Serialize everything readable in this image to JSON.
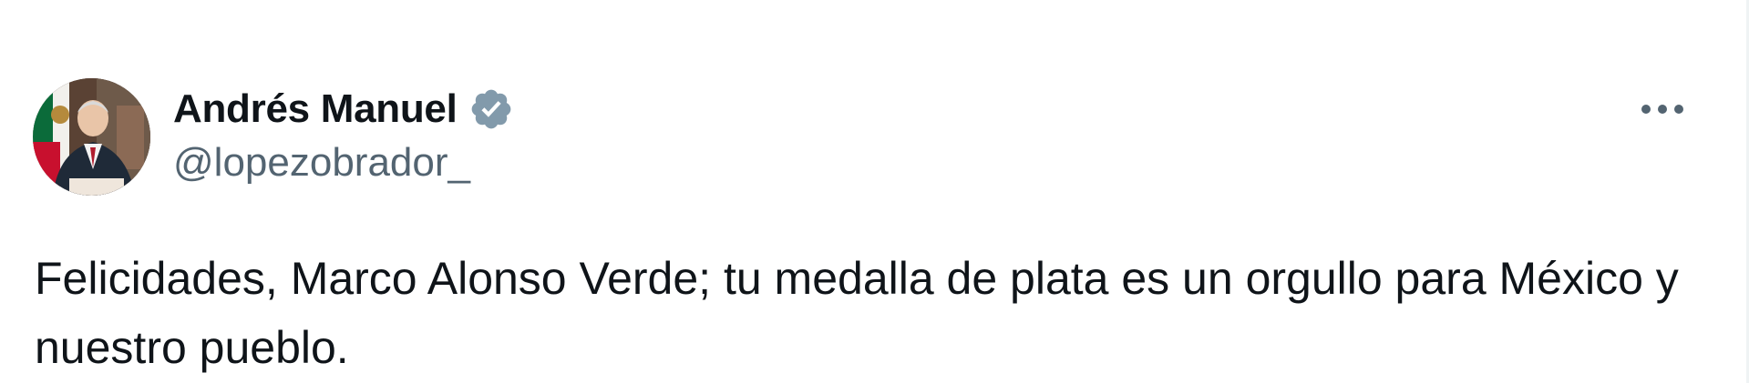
{
  "tweet": {
    "author": {
      "display_name": "Andrés Manuel",
      "handle": "@lopezobrador_",
      "verified": true,
      "avatar_icon": "profile-photo-icon"
    },
    "more_icon": "more-options-icon",
    "text": "Felicidades, Marco Alonso Verde; tu medalla de plata es un orgullo para México y nuestro pueblo."
  },
  "colors": {
    "text": "#0f1419",
    "secondary_text": "#536471",
    "verified_badge": "#829aab",
    "background": "#ffffff"
  }
}
